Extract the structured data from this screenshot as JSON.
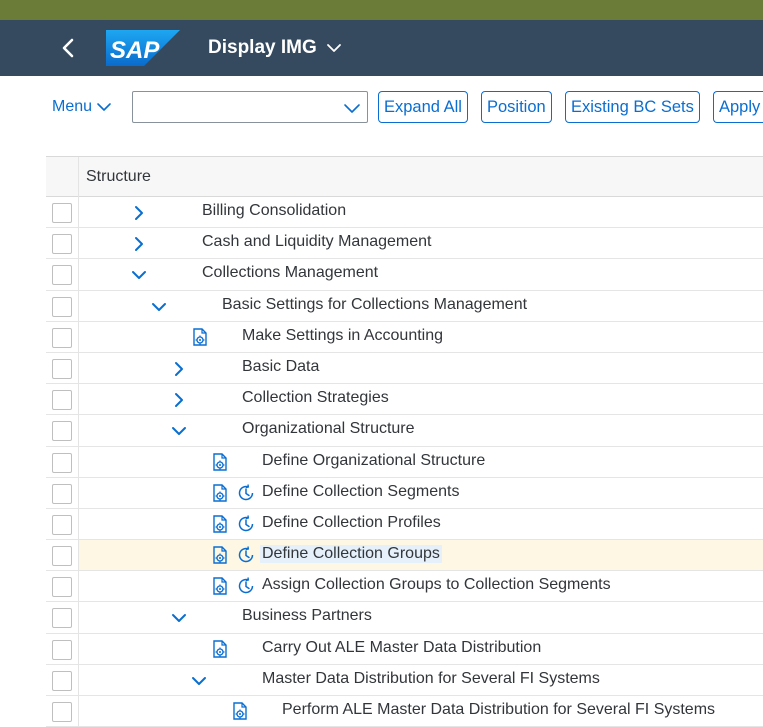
{
  "shell": {
    "logo_text": "SAP",
    "title": "Display IMG"
  },
  "toolbar": {
    "menu_label": "Menu",
    "search_value": "",
    "expand_all_label": "Expand All",
    "position_label": "Position",
    "existing_bc_sets_label": "Existing BC Sets",
    "apply_label": "Apply"
  },
  "table": {
    "header": "Structure",
    "rows": [
      {
        "label": "Billing Consolidation",
        "expander": "collapsed",
        "icons": []
      },
      {
        "label": "Cash and Liquidity Management",
        "expander": "collapsed",
        "icons": []
      },
      {
        "label": "Collections Management",
        "expander": "expanded",
        "icons": []
      },
      {
        "label": "Basic Settings for Collections Management",
        "expander": "expanded",
        "icons": []
      },
      {
        "label": "Make Settings in Accounting",
        "expander": "none",
        "icons": [
          "execute-icon"
        ]
      },
      {
        "label": "Basic Data",
        "expander": "collapsed",
        "icons": []
      },
      {
        "label": "Collection Strategies",
        "expander": "collapsed",
        "icons": []
      },
      {
        "label": "Organizational Structure",
        "expander": "expanded",
        "icons": []
      },
      {
        "label": "Define Organizational Structure",
        "expander": "none",
        "icons": [
          "execute-icon"
        ]
      },
      {
        "label": "Define Collection Segments",
        "expander": "none",
        "icons": [
          "execute-icon",
          "clock-icon"
        ]
      },
      {
        "label": "Define Collection Profiles",
        "expander": "none",
        "icons": [
          "execute-icon",
          "clock-icon"
        ]
      },
      {
        "label": "Define Collection Groups",
        "expander": "none",
        "icons": [
          "execute-icon",
          "clock-icon"
        ],
        "selected": true
      },
      {
        "label": "Assign Collection Groups to Collection Segments",
        "expander": "none",
        "icons": [
          "execute-icon",
          "clock-icon"
        ]
      },
      {
        "label": "Business Partners",
        "expander": "expanded",
        "icons": []
      },
      {
        "label": "Carry Out ALE Master Data Distribution",
        "expander": "none",
        "icons": [
          "execute-icon"
        ]
      },
      {
        "label": "Master Data Distribution for Several FI Systems",
        "expander": "expanded",
        "icons": []
      },
      {
        "label": "Perform ALE Master Data Distribution for Several FI Systems",
        "expander": "none",
        "icons": [
          "execute-icon"
        ]
      }
    ]
  },
  "colors": {
    "shell_bg": "#354a5f",
    "top_stripe": "#6b7c39",
    "accent": "#0a6ed1",
    "selected_row": "#fef7e3"
  }
}
